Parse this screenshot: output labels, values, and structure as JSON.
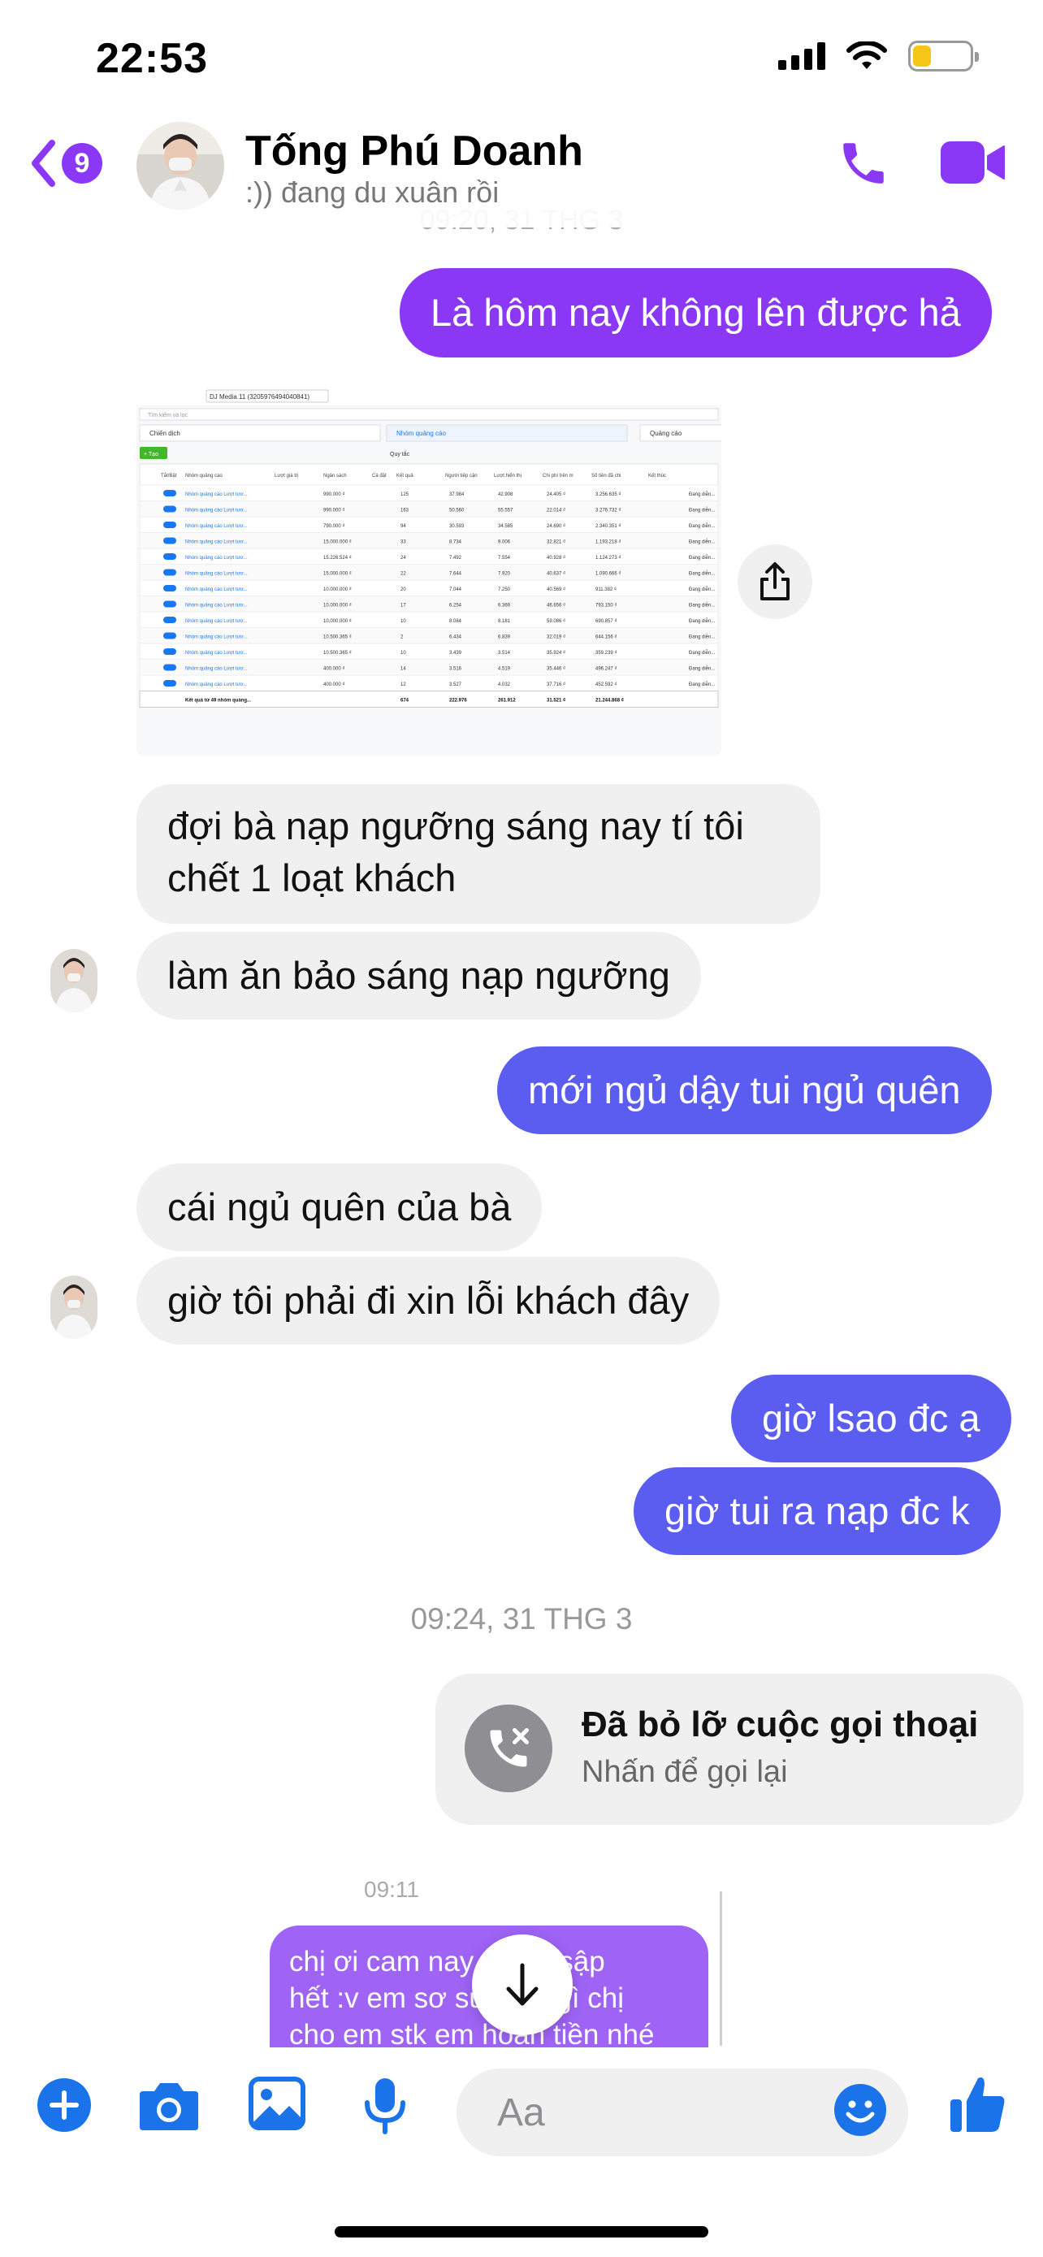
{
  "status_bar": {
    "time": "22:53",
    "battery_level": 0.32
  },
  "header": {
    "unread_count": "9",
    "contact_name": "Tống Phú Doanh",
    "contact_status": ":)) đang du xuân rồi"
  },
  "thread": {
    "peek_timestamp": "09:20, 31 THG 3",
    "messages": [
      {
        "from": "me",
        "text": "Là hôm nay không lên được hả"
      },
      {
        "from": "them",
        "text_line1": "đợi bà nạp ngưỡng sáng nay tí tôi",
        "text_line2": "chết 1 loạt khách"
      },
      {
        "from": "them",
        "text": "làm ăn bảo sáng nạp ngưỡng"
      },
      {
        "from": "me",
        "text": "mới ngủ dậy tui ngủ quên"
      },
      {
        "from": "them",
        "text": "cái ngủ quên của bà"
      },
      {
        "from": "them",
        "text": "giờ tôi phải đi xin lỗi khách đây"
      },
      {
        "from": "me",
        "text": "giờ lsao đc ạ"
      },
      {
        "from": "me",
        "text": "giờ tui ra nạp đc k"
      }
    ],
    "timestamp": "09:24, 31 THG 3",
    "missed_call": {
      "title": "Đã bỏ lỡ cuộc gọi thoại",
      "subtitle": "Nhấn để gọi lại"
    },
    "quoted": {
      "time": "09:11",
      "line1": "chị ơi cam nay em bị sập",
      "line2": "hết :v em sơ sure có gì chị",
      "line3": "cho em stk em hoàn tiền nhé"
    }
  },
  "screenshot_attachment": {
    "account_label": "DJ Media 11 (3205976494040841)",
    "search_placeholder": "Tìm kiếm và lọc",
    "tabs": [
      "Chiến dịch",
      "Nhóm quảng cáo",
      "Quảng cáo"
    ],
    "create_label": "+ Tạo",
    "rule_label": "Quy tắc",
    "columns": [
      "Tắt/Bật",
      "Nhóm quảng cáo",
      "Lượt giá trị",
      "Ngân sách",
      "Cả đặt",
      "Kết quả",
      "Người tiếp cận",
      "Lượt hiển thị",
      "Chi phí trên mỗi kết quả",
      "Số tiền đã chi tiêu",
      "Kết thúc"
    ],
    "rows": [
      {
        "name": "Nhóm quảng cáo Lượt tươ...",
        "budget": "990.000 ₫",
        "results": "125",
        "reach": "37.984",
        "impr": "42.908",
        "cpr": "24.405 ₫",
        "spent": "3.256.635 ₫"
      },
      {
        "name": "Nhóm quảng cáo Lượt tươ...",
        "budget": "990.000 ₫",
        "results": "163",
        "reach": "50.560",
        "impr": "55.557",
        "cpr": "22.014 ₫",
        "spent": "3.276.732 ₫"
      },
      {
        "name": "Nhóm quảng cáo Lượt tươ...",
        "budget": "790.000 ₫",
        "results": "94",
        "reach": "30.593",
        "impr": "34.585",
        "cpr": "24.690 ₫",
        "spent": "2.340.351 ₫"
      },
      {
        "name": "Nhóm quảng cáo Lượt tươ...",
        "budget": "15.000.000 ₫",
        "results": "33",
        "reach": "8.734",
        "impr": "9.006",
        "cpr": "32.821 ₫",
        "spent": "1.193.218 ₫"
      },
      {
        "name": "Nhóm quảng cáo Lượt tươ...",
        "budget": "15.226.524 ₫",
        "results": "24",
        "reach": "7.492",
        "impr": "7.554",
        "cpr": "40.928 ₫",
        "spent": "1.124.273 ₫"
      },
      {
        "name": "Nhóm quảng cáo Lượt tươ...",
        "budget": "15.000.000 ₫",
        "results": "22",
        "reach": "7.644",
        "impr": "7.920",
        "cpr": "40.637 ₫",
        "spent": "1.090.666 ₫"
      },
      {
        "name": "Nhóm quảng cáo Lượt tươ...",
        "budget": "10.000.000 ₫",
        "results": "20",
        "reach": "7.044",
        "impr": "7.250",
        "cpr": "40.569 ₫",
        "spent": "911.382 ₫"
      },
      {
        "name": "Nhóm quảng cáo Lượt tươ...",
        "budget": "10.000.000 ₫",
        "results": "17",
        "reach": "6.254",
        "impr": "6.369",
        "cpr": "46.656 ₫",
        "spent": "793.150 ₫"
      },
      {
        "name": "Nhóm quảng cáo Lượt tươ...",
        "budget": "10.000.000 ₫",
        "results": "10",
        "reach": "8.084",
        "impr": "8.181",
        "cpr": "59.086 ₫",
        "spent": "690.857 ₫"
      },
      {
        "name": "Nhóm quảng cáo Lượt tươ...",
        "budget": "10.500.365 ₫",
        "results": "2",
        "reach": "6.434",
        "impr": "6.839",
        "cpr": "32.019 ₫",
        "spent": "644.156 ₫"
      },
      {
        "name": "Nhóm quảng cáo Lượt tươ...",
        "budget": "10.500.365 ₫",
        "results": "10",
        "reach": "3.439",
        "impr": "3.514",
        "cpr": "35.924 ₫",
        "spent": "359.239 ₫"
      },
      {
        "name": "Nhóm quảng cáo Lượt tươ...",
        "budget": "400.000 ₫",
        "results": "14",
        "reach": "3.516",
        "impr": "4.519",
        "cpr": "35.446 ₫",
        "spent": "496.247 ₫"
      },
      {
        "name": "Nhóm quảng cáo Lượt tươ...",
        "budget": "400.000 ₫",
        "results": "12",
        "reach": "3.527",
        "impr": "4.032",
        "cpr": "37.716 ₫",
        "spent": "452.592 ₫"
      }
    ],
    "status_cell": "Đang diễn...",
    "total_row": {
      "label": "Kết quả từ 49 nhóm quảng...",
      "results": "674",
      "reach": "222.976",
      "impr": "261.912",
      "cpr": "31.521 ₫",
      "spent": "21.244.868 ₫"
    }
  },
  "composer": {
    "placeholder": "Aa"
  },
  "colors": {
    "accent": "#8a38f5",
    "outgoing_blue": "#5b5df0",
    "incoming": "#f0f0f0"
  }
}
